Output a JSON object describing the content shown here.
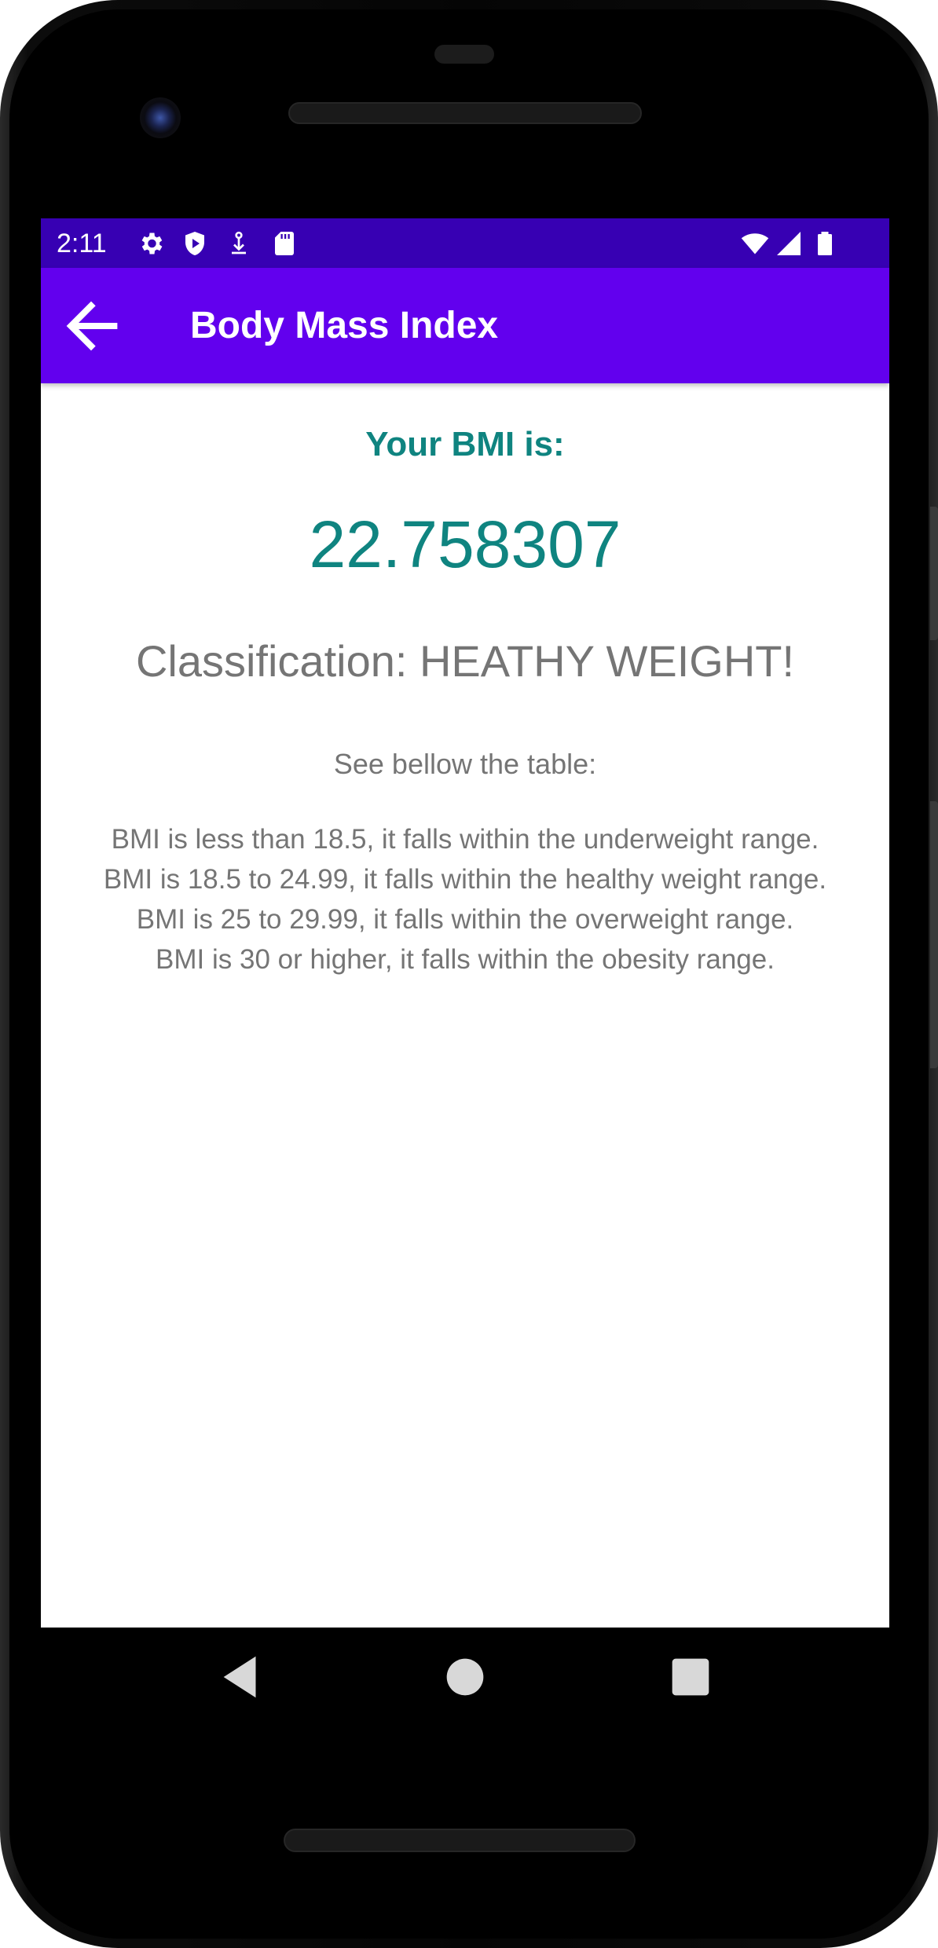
{
  "status_bar": {
    "time": "2:11",
    "left_icons": [
      "gear-icon",
      "shield-play-icon",
      "download-icon",
      "sd-card-icon"
    ],
    "right_icons": [
      "wifi-icon",
      "cellular-signal-icon",
      "battery-icon"
    ]
  },
  "app_bar": {
    "title": "Body Mass Index",
    "back_icon": "arrow-back-icon",
    "color": "#6200ee",
    "status_color": "#3700b3"
  },
  "result": {
    "label": "Your BMI is:",
    "value": "22.758307",
    "classification": "Classification: HEATHY WEIGHT!",
    "accent_color": "#0f8480"
  },
  "info": {
    "intro": "See bellow the table:",
    "table_lines": [
      "BMI is less than 18.5, it falls within the underweight range.",
      "BMI is 18.5 to 24.99, it falls within the healthy weight range.",
      "BMI is 25 to 29.99, it falls within the overweight range.",
      "BMI is 30 or higher, it falls within the obesity range."
    ]
  },
  "nav_bar": {
    "icons": [
      "back-triangle-icon",
      "home-circle-icon",
      "recents-square-icon"
    ]
  }
}
